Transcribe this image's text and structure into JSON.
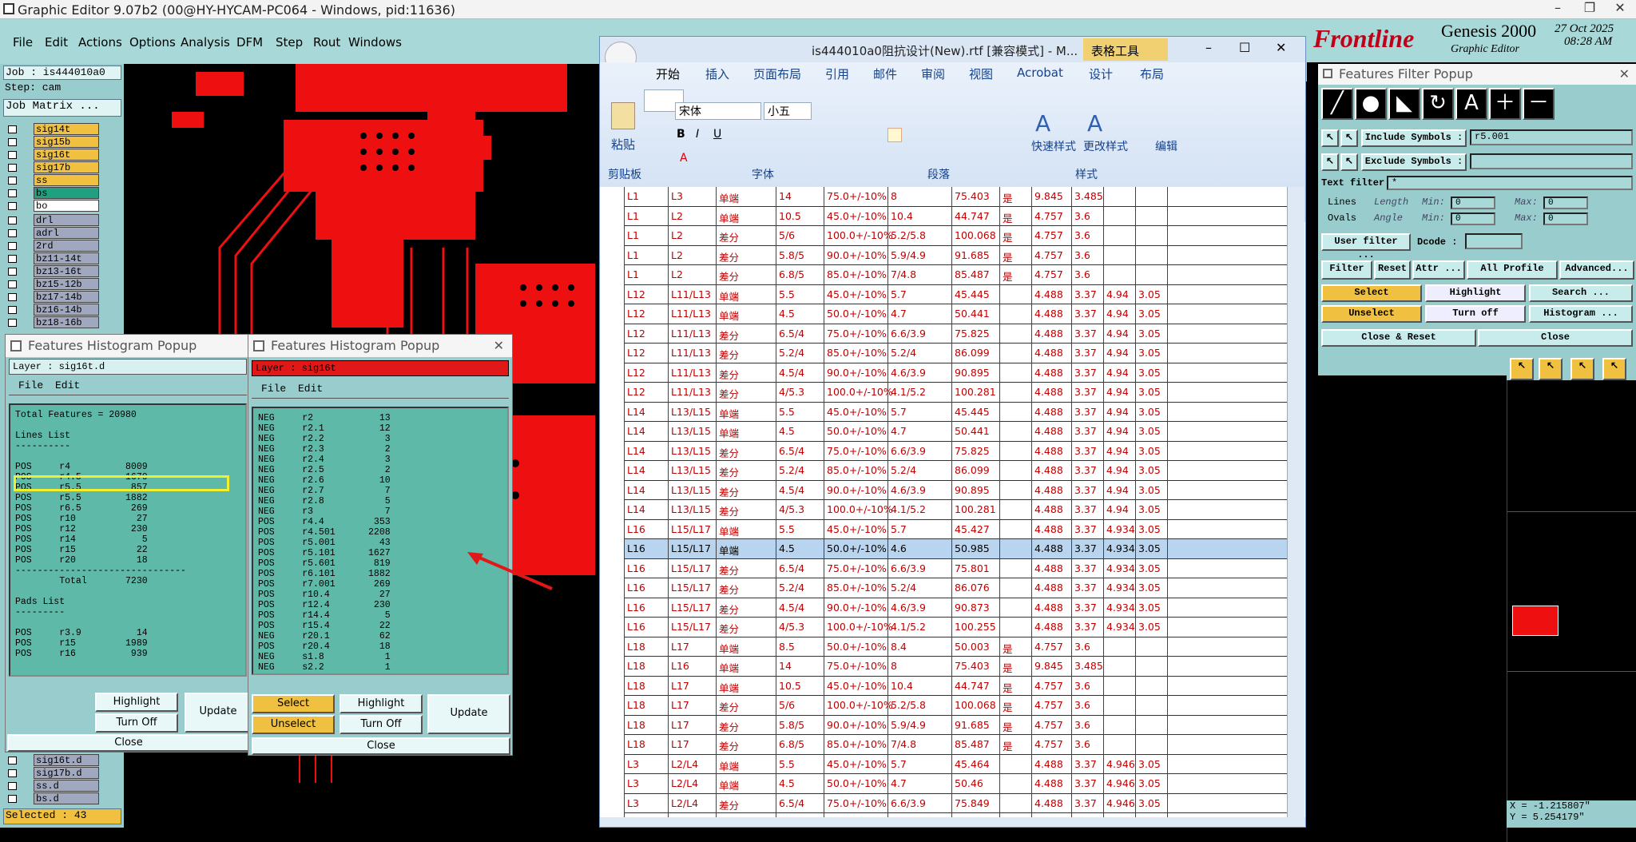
{
  "window": {
    "title": "Graphic Editor 9.07b2 (00@HY-HYCAM-PC064 - Windows, pid:11636)"
  },
  "menu": [
    "File",
    "Edit",
    "Actions",
    "Options",
    "Analysis",
    "DFM",
    "Step",
    "Rout",
    "Windows"
  ],
  "left": {
    "job": "Job : is444010a0",
    "step": "Step: cam",
    "job_matrix": "Job Matrix ...",
    "layers_top": [
      "sig14t",
      "sig15b",
      "sig16t",
      "sig17b",
      "ss",
      "bs",
      "bo"
    ],
    "layers_mid": [
      "drl",
      "adrl",
      "2rd",
      "bz11-14t",
      "bz13-16t",
      "bz15-12b",
      "bz17-14b",
      "bz16-14b",
      "bz18-16b"
    ],
    "layers_bottom": [
      "sig16t.d",
      "sig17b.d",
      "ss.d",
      "bs.d"
    ],
    "selected": "Selected : 43"
  },
  "hist1": {
    "title": "Features Histogram Popup",
    "layer": "Layer :  sig16t.d",
    "file": "File",
    "edit": "Edit",
    "lines": [
      "Total Features = 20980",
      "",
      "Lines List",
      "----------",
      "",
      "POS     r4          8009",
      "POS     r4.5        1670",
      "POS     r5.5         857",
      "POS     r5.5        1882",
      "POS     r6.5         269",
      "POS     r10           27",
      "POS     r12          230",
      "POS     r14            5",
      "POS     r15           22",
      "POS     r20           18",
      "-------------------------------",
      "        Total       7230",
      "",
      "Pads List",
      "---------",
      "",
      "POS     r3.9          14",
      "POS     r15         1989",
      "POS     r16          939"
    ],
    "highlight": "Highlight",
    "turnoff": "Turn Off",
    "update": "Update",
    "close": "Close"
  },
  "hist2": {
    "title": "Features Histogram Popup",
    "layer": "Layer :  sig16t",
    "file": "File",
    "edit": "Edit",
    "lines": [
      "NEG     r2            13",
      "NEG     r2.1          12",
      "NEG     r2.2           3",
      "NEG     r2.3           2",
      "NEG     r2.4           3",
      "NEG     r2.5           2",
      "NEG     r2.6          10",
      "NEG     r2.7           7",
      "NEG     r2.8           5",
      "NEG     r3             7",
      "POS     r4.4         353",
      "POS     r4.501      2208",
      "POS     r5.001        43",
      "POS     r5.101      1627",
      "POS     r5.601       819",
      "POS     r6.101      1882",
      "POS     r7.001       269",
      "POS     r10.4         27",
      "POS     r12.4        230",
      "POS     r14.4          5",
      "POS     r15.4         22",
      "NEG     r20.1         62",
      "POS     r20.4         18",
      "NEG     s1.8           1",
      "NEG     s2.2           1"
    ],
    "select": "Select",
    "highlight": "Highlight",
    "update": "Update",
    "unselect": "Unselect",
    "turnoff": "Turn Off",
    "close": "Close"
  },
  "word": {
    "title": "is444010a0阻抗设计(New).rtf [兼容模式] - M...",
    "tools": "表格工具",
    "tabs": [
      "开始",
      "插入",
      "页面布局",
      "引用",
      "邮件",
      "审阅",
      "视图",
      "Acrobat",
      "设计",
      "布局"
    ],
    "font": "宋体",
    "size": "小五",
    "paste": "粘贴",
    "quick_style": "快速样式",
    "change_style": "更改样式",
    "edit": "编辑",
    "groups": [
      "剪贴板",
      "字体",
      "段落",
      "样式"
    ],
    "rows": [
      [
        "L1",
        "L3",
        "单端",
        "14",
        "75.0+/-10%",
        "8",
        "75.403",
        "是",
        "9.845",
        "3.485",
        "",
        ""
      ],
      [
        "L1",
        "L2",
        "单端",
        "10.5",
        "45.0+/-10%",
        "10.4",
        "44.747",
        "是",
        "4.757",
        "3.6",
        "",
        ""
      ],
      [
        "L1",
        "L2",
        "差分",
        "5/6",
        "100.0+/-10%",
        "5.2/5.8",
        "100.068",
        "是",
        "4.757",
        "3.6",
        "",
        ""
      ],
      [
        "L1",
        "L2",
        "差分",
        "5.8/5",
        "90.0+/-10%",
        "5.9/4.9",
        "91.685",
        "是",
        "4.757",
        "3.6",
        "",
        ""
      ],
      [
        "L1",
        "L2",
        "差分",
        "6.8/5",
        "85.0+/-10%",
        "7/4.8",
        "85.487",
        "是",
        "4.757",
        "3.6",
        "",
        ""
      ],
      [
        "L12",
        "L11/L13",
        "单端",
        "5.5",
        "45.0+/-10%",
        "5.7",
        "45.445",
        "",
        "4.488",
        "3.37",
        "4.94",
        "3.05"
      ],
      [
        "L12",
        "L11/L13",
        "单端",
        "4.5",
        "50.0+/-10%",
        "4.7",
        "50.441",
        "",
        "4.488",
        "3.37",
        "4.94",
        "3.05"
      ],
      [
        "L12",
        "L11/L13",
        "差分",
        "6.5/4",
        "75.0+/-10%",
        "6.6/3.9",
        "75.825",
        "",
        "4.488",
        "3.37",
        "4.94",
        "3.05"
      ],
      [
        "L12",
        "L11/L13",
        "差分",
        "5.2/4",
        "85.0+/-10%",
        "5.2/4",
        "86.099",
        "",
        "4.488",
        "3.37",
        "4.94",
        "3.05"
      ],
      [
        "L12",
        "L11/L13",
        "差分",
        "4.5/4",
        "90.0+/-10%",
        "4.6/3.9",
        "90.895",
        "",
        "4.488",
        "3.37",
        "4.94",
        "3.05"
      ],
      [
        "L12",
        "L11/L13",
        "差分",
        "4/5.3",
        "100.0+/-10%",
        "4.1/5.2",
        "100.281",
        "",
        "4.488",
        "3.37",
        "4.94",
        "3.05"
      ],
      [
        "L14",
        "L13/L15",
        "单端",
        "5.5",
        "45.0+/-10%",
        "5.7",
        "45.445",
        "",
        "4.488",
        "3.37",
        "4.94",
        "3.05"
      ],
      [
        "L14",
        "L13/L15",
        "单端",
        "4.5",
        "50.0+/-10%",
        "4.7",
        "50.441",
        "",
        "4.488",
        "3.37",
        "4.94",
        "3.05"
      ],
      [
        "L14",
        "L13/L15",
        "差分",
        "6.5/4",
        "75.0+/-10%",
        "6.6/3.9",
        "75.825",
        "",
        "4.488",
        "3.37",
        "4.94",
        "3.05"
      ],
      [
        "L14",
        "L13/L15",
        "差分",
        "5.2/4",
        "85.0+/-10%",
        "5.2/4",
        "86.099",
        "",
        "4.488",
        "3.37",
        "4.94",
        "3.05"
      ],
      [
        "L14",
        "L13/L15",
        "差分",
        "4.5/4",
        "90.0+/-10%",
        "4.6/3.9",
        "90.895",
        "",
        "4.488",
        "3.37",
        "4.94",
        "3.05"
      ],
      [
        "L14",
        "L13/L15",
        "差分",
        "4/5.3",
        "100.0+/-10%",
        "4.1/5.2",
        "100.281",
        "",
        "4.488",
        "3.37",
        "4.94",
        "3.05"
      ],
      [
        "L16",
        "L15/L17",
        "单端",
        "5.5",
        "45.0+/-10%",
        "5.7",
        "45.427",
        "",
        "4.488",
        "3.37",
        "4.934",
        "3.05"
      ],
      [
        "L16",
        "L15/L17",
        "单端",
        "4.5",
        "50.0+/-10%",
        "4.6",
        "50.985",
        "",
        "4.488",
        "3.37",
        "4.934",
        "3.05"
      ],
      [
        "L16",
        "L15/L17",
        "差分",
        "6.5/4",
        "75.0+/-10%",
        "6.6/3.9",
        "75.801",
        "",
        "4.488",
        "3.37",
        "4.934",
        "3.05"
      ],
      [
        "L16",
        "L15/L17",
        "差分",
        "5.2/4",
        "85.0+/-10%",
        "5.2/4",
        "86.076",
        "",
        "4.488",
        "3.37",
        "4.934",
        "3.05"
      ],
      [
        "L16",
        "L15/L17",
        "差分",
        "4.5/4",
        "90.0+/-10%",
        "4.6/3.9",
        "90.873",
        "",
        "4.488",
        "3.37",
        "4.934",
        "3.05"
      ],
      [
        "L16",
        "L15/L17",
        "差分",
        "4/5.3",
        "100.0+/-10%",
        "4.1/5.2",
        "100.255",
        "",
        "4.488",
        "3.37",
        "4.934",
        "3.05"
      ],
      [
        "L18",
        "L17",
        "单端",
        "8.5",
        "50.0+/-10%",
        "8.4",
        "50.003",
        "是",
        "4.757",
        "3.6",
        "",
        ""
      ],
      [
        "L18",
        "L16",
        "单端",
        "14",
        "75.0+/-10%",
        "8",
        "75.403",
        "是",
        "9.845",
        "3.485",
        "",
        ""
      ],
      [
        "L18",
        "L17",
        "单端",
        "10.5",
        "45.0+/-10%",
        "10.4",
        "44.747",
        "是",
        "4.757",
        "3.6",
        "",
        ""
      ],
      [
        "L18",
        "L17",
        "差分",
        "5/6",
        "100.0+/-10%",
        "5.2/5.8",
        "100.068",
        "是",
        "4.757",
        "3.6",
        "",
        ""
      ],
      [
        "L18",
        "L17",
        "差分",
        "5.8/5",
        "90.0+/-10%",
        "5.9/4.9",
        "91.685",
        "是",
        "4.757",
        "3.6",
        "",
        ""
      ],
      [
        "L18",
        "L17",
        "差分",
        "6.8/5",
        "85.0+/-10%",
        "7/4.8",
        "85.487",
        "是",
        "4.757",
        "3.6",
        "",
        ""
      ],
      [
        "L3",
        "L2/L4",
        "单端",
        "5.5",
        "45.0+/-10%",
        "5.7",
        "45.464",
        "",
        "4.488",
        "3.37",
        "4.946",
        "3.05"
      ],
      [
        "L3",
        "L2/L4",
        "单端",
        "4.5",
        "50.0+/-10%",
        "4.7",
        "50.46",
        "",
        "4.488",
        "3.37",
        "4.946",
        "3.05"
      ],
      [
        "L3",
        "L2/L4",
        "差分",
        "6.5/4",
        "75.0+/-10%",
        "6.6/3.9",
        "75.849",
        "",
        "4.488",
        "3.37",
        "4.946",
        "3.05"
      ],
      [
        "L3",
        "L2/L4",
        "差分",
        "5.2/4",
        "85.0+/-10%",
        "5.2/4",
        "86.12",
        "",
        "4.488",
        "3.37",
        "4.946",
        "3.05"
      ]
    ]
  },
  "genesis": {
    "brand": "Frontline",
    "product": "Genesis 2000",
    "sub": "Graphic Editor",
    "date": "27 Oct 2025",
    "time": "08:28 AM"
  },
  "filter": {
    "title": "Features Filter Popup",
    "include": "Include Symbols :",
    "include_val": "r5.001",
    "exclude": "Exclude Symbols :",
    "text_filter": "Text filter",
    "text_val": "*",
    "lines": "Lines",
    "ovals": "Ovals",
    "length": "Length",
    "angle": "Angle",
    "min": "Min:",
    "max": "Max:",
    "zero": "0",
    "user_filter": "User filter ...",
    "dcode": "Dcode :",
    "filter": "Filter",
    "reset": "Reset",
    "attr": "Attr ...",
    "all_profile": "All Profile",
    "advanced": "Advanced...",
    "select": "Select",
    "highlight": "Highlight",
    "search": "Search ...",
    "unselect": "Unselect",
    "turnoff": "Turn off",
    "histogram": "Histogram ...",
    "close_reset": "Close & Reset",
    "close": "Close"
  },
  "coords": {
    "x": "X = -1.215807\"",
    "y": "Y = 5.254179\""
  }
}
